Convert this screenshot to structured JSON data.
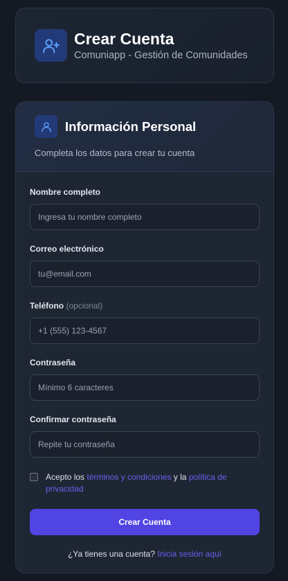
{
  "header": {
    "icon": "user-plus-icon",
    "title": "Crear Cuenta",
    "subtitle": "Comuniapp - Gestión de Comunidades"
  },
  "section": {
    "icon": "user-icon",
    "title": "Información Personal",
    "description": "Completa los datos para crear tu cuenta"
  },
  "fields": {
    "name": {
      "label": "Nombre completo",
      "placeholder": "Ingresa tu nombre completo",
      "value": ""
    },
    "email": {
      "label": "Correo electrónico",
      "placeholder": "tu@email.com",
      "value": ""
    },
    "phone": {
      "label": "Teléfono",
      "optional": "(opcional)",
      "placeholder": "+1 (555) 123-4567",
      "value": ""
    },
    "password": {
      "label": "Contraseña",
      "placeholder": "Mínimo 6 caracteres",
      "value": ""
    },
    "confirm": {
      "label": "Confirmar contraseña",
      "placeholder": "Repite tu contraseña",
      "value": ""
    }
  },
  "terms": {
    "checked": false,
    "prefix": "Acepto los",
    "terms_link": "términos y condiciones",
    "middle": "y la",
    "privacy_link": "política de privacidad"
  },
  "submit_label": "Crear Cuenta",
  "login": {
    "prompt": "¿Ya tienes una cuenta?",
    "link": "Inicia sesión aquí"
  },
  "colors": {
    "background": "#131a24",
    "accent": "#5044e3",
    "link": "#6c5ff0",
    "icon_tile": "#223a78"
  }
}
